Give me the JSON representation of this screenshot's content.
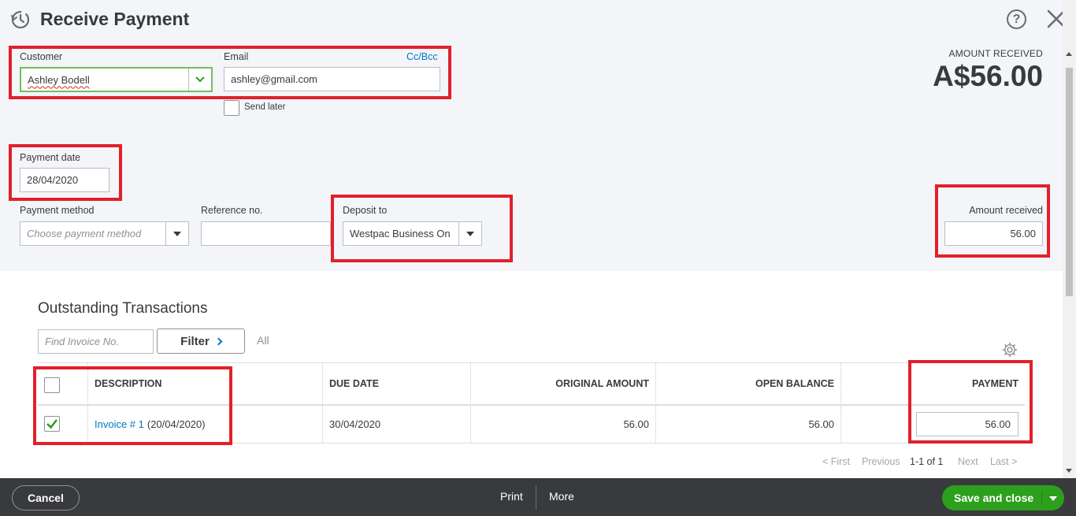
{
  "header": {
    "title": "Receive Payment",
    "help_label": "?"
  },
  "customer": {
    "label": "Customer",
    "value": "Ashley Bodell"
  },
  "email": {
    "label": "Email",
    "value": "ashley@gmail.com",
    "cc_bcc": "Cc/Bcc",
    "send_later_label": "Send later",
    "send_later_checked": false
  },
  "amount_received_summary": {
    "caption": "AMOUNT RECEIVED",
    "value": "A$56.00"
  },
  "payment_date": {
    "label": "Payment date",
    "value": "28/04/2020"
  },
  "payment_method": {
    "label": "Payment method",
    "placeholder": "Choose payment method"
  },
  "reference_no": {
    "label": "Reference no.",
    "value": ""
  },
  "deposit_to": {
    "label": "Deposit to",
    "value": "Westpac Business On"
  },
  "amount_received_field": {
    "label": "Amount received",
    "value": "56.00"
  },
  "outstanding": {
    "title": "Outstanding Transactions",
    "search_placeholder": "Find Invoice No.",
    "filter_label": "Filter",
    "all_label": "All",
    "columns": {
      "description": "DESCRIPTION",
      "due_date": "DUE DATE",
      "original_amount": "ORIGINAL AMOUNT",
      "open_balance": "OPEN BALANCE",
      "payment": "PAYMENT"
    },
    "rows": [
      {
        "checked": true,
        "invoice_link": "Invoice # 1",
        "invoice_date": "(20/04/2020)",
        "due_date": "30/04/2020",
        "original_amount": "56.00",
        "open_balance": "56.00",
        "payment": "56.00"
      }
    ],
    "pagination": {
      "first": "< First",
      "previous": "Previous",
      "range": "1-1 of 1",
      "next": "Next",
      "last": "Last >"
    }
  },
  "footer": {
    "cancel_label": "Cancel",
    "print_label": "Print",
    "more_label": "More",
    "save_label": "Save and close"
  },
  "colors": {
    "highlight_box": "#e2202a",
    "save_green": "#2ca01c",
    "link_blue": "#0077c5",
    "footer_bg": "#393a3d",
    "top_panel_bg": "#f4f5f8"
  }
}
